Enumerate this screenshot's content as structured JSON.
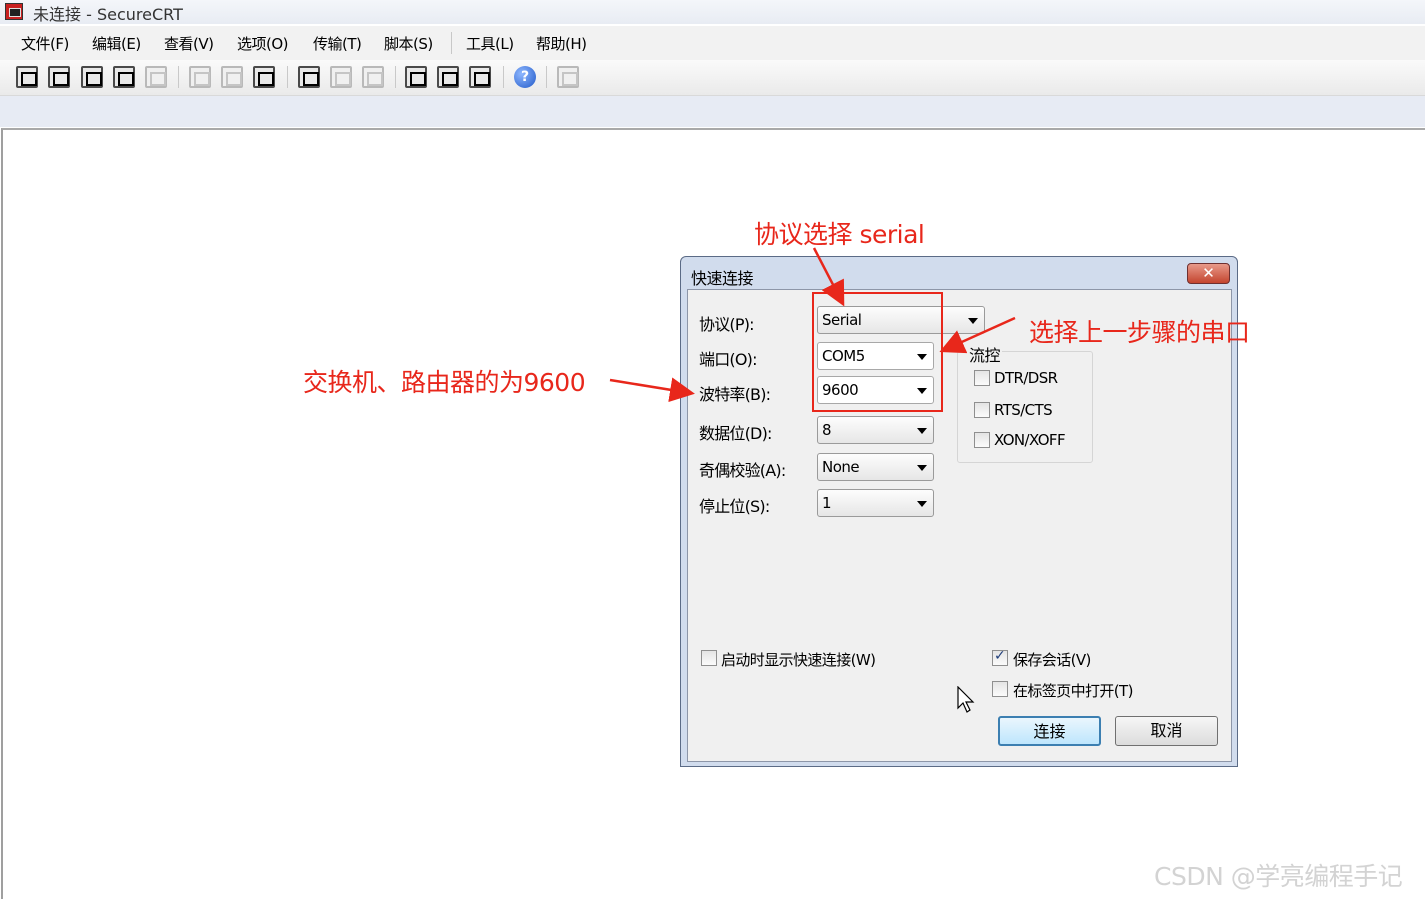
{
  "window": {
    "title": "未连接 - SecureCRT"
  },
  "menu": [
    "文件(F)",
    "编辑(E)",
    "查看(V)",
    "选项(O)",
    "传输(T)",
    "脚本(S)",
    "工具(L)",
    "帮助(H)"
  ],
  "dialog": {
    "title": "快速连接",
    "fields": [
      {
        "label": "协议(P):",
        "value": "Serial"
      },
      {
        "label": "端口(O):",
        "value": "COM5"
      },
      {
        "label": "波特率(B):",
        "value": "9600"
      },
      {
        "label": "数据位(D):",
        "value": "8"
      },
      {
        "label": "奇偶校验(A):",
        "value": "None"
      },
      {
        "label": "停止位(S):",
        "value": "1"
      }
    ],
    "flow_control": {
      "title": "流控",
      "options": [
        {
          "label": "DTR/DSR",
          "checked": false
        },
        {
          "label": "RTS/CTS",
          "checked": false
        },
        {
          "label": "XON/XOFF",
          "checked": false
        }
      ]
    },
    "show_on_startup": {
      "label": "启动时显示快速连接(W)",
      "checked": false
    },
    "save_session": {
      "label": "保存会话(V)",
      "checked": true
    },
    "open_in_tab": {
      "label": "在标签页中打开(T)",
      "checked": false
    },
    "connect_label": "连接",
    "cancel_label": "取消"
  },
  "annotations": {
    "protocol": "协议选择 serial",
    "port": "选择上一步骤的串口",
    "baud": "交换机、路由器的为9600",
    "color": "#e8271b"
  },
  "watermark": "CSDN @学亮编程手记"
}
